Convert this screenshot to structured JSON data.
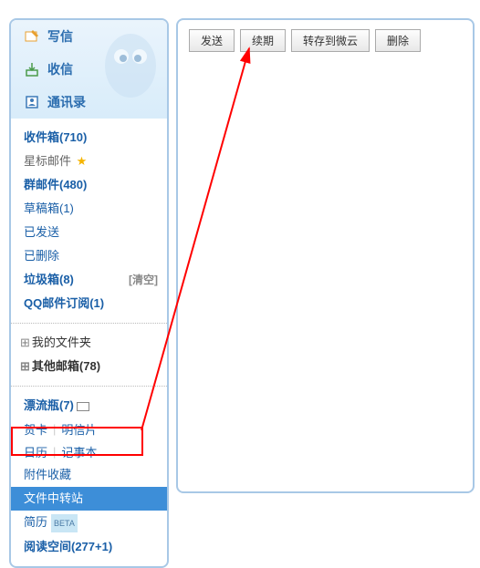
{
  "top_nav": {
    "compose": "写信",
    "receive": "收信",
    "contacts": "通讯录"
  },
  "folders": {
    "inbox": "收件箱(710)",
    "starred": "星标邮件",
    "group": "群邮件(480)",
    "drafts": "草稿箱(1)",
    "sent": "已发送",
    "deleted": "已删除",
    "trash": "垃圾箱(8)",
    "trash_clear": "[清空]",
    "subscription": "QQ邮件订阅(1)"
  },
  "tree": {
    "my_folders": "我的文件夹",
    "other_mailbox": "其他邮箱(78)"
  },
  "extras": {
    "bottle": "漂流瓶(7)",
    "greeting": "贺卡",
    "postcard": "明信片",
    "calendar": "日历",
    "notebook": "记事本",
    "attachment": "附件收藏",
    "file_transfer": "文件中转站",
    "resume": "简历",
    "beta": "BETA",
    "reading": "阅读空间(277+1)"
  },
  "toolbar": {
    "send": "发送",
    "renew": "续期",
    "save_cloud": "转存到微云",
    "delete": "删除"
  }
}
